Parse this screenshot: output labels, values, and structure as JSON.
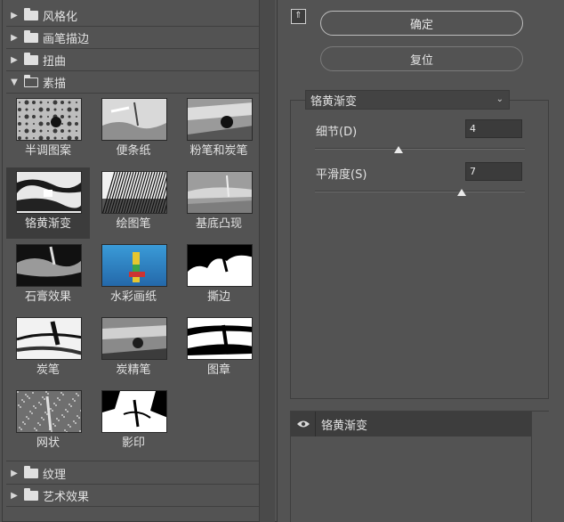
{
  "gallery": {
    "categories_top": [
      {
        "label": "风格化",
        "expanded": false
      },
      {
        "label": "画笔描边",
        "expanded": false
      },
      {
        "label": "扭曲",
        "expanded": false
      },
      {
        "label": "素描",
        "expanded": true
      }
    ],
    "filters": [
      {
        "label": "半调图案",
        "selected": false
      },
      {
        "label": "便条纸",
        "selected": false
      },
      {
        "label": "粉笔和炭笔",
        "selected": false
      },
      {
        "label": "铬黄渐变",
        "selected": true
      },
      {
        "label": "绘图笔",
        "selected": false
      },
      {
        "label": "基底凸现",
        "selected": false
      },
      {
        "label": "石膏效果",
        "selected": false
      },
      {
        "label": "水彩画纸",
        "selected": false
      },
      {
        "label": "撕边",
        "selected": false
      },
      {
        "label": "炭笔",
        "selected": false
      },
      {
        "label": "炭精笔",
        "selected": false
      },
      {
        "label": "图章",
        "selected": false
      },
      {
        "label": "网状",
        "selected": false
      },
      {
        "label": "影印",
        "selected": false
      }
    ],
    "categories_bottom": [
      {
        "label": "纹理",
        "expanded": false
      },
      {
        "label": "艺术效果",
        "expanded": false
      }
    ]
  },
  "actions": {
    "ok_label": "确定",
    "reset_label": "复位"
  },
  "settings": {
    "filter_selected": "铬黄渐变",
    "params": [
      {
        "label": "细节(D)",
        "value": "4",
        "fraction": 0.4
      },
      {
        "label": "平滑度(S)",
        "value": "7",
        "fraction": 0.7
      }
    ]
  },
  "layers": {
    "items": [
      {
        "name": "铬黄渐变",
        "visible": true
      }
    ]
  }
}
